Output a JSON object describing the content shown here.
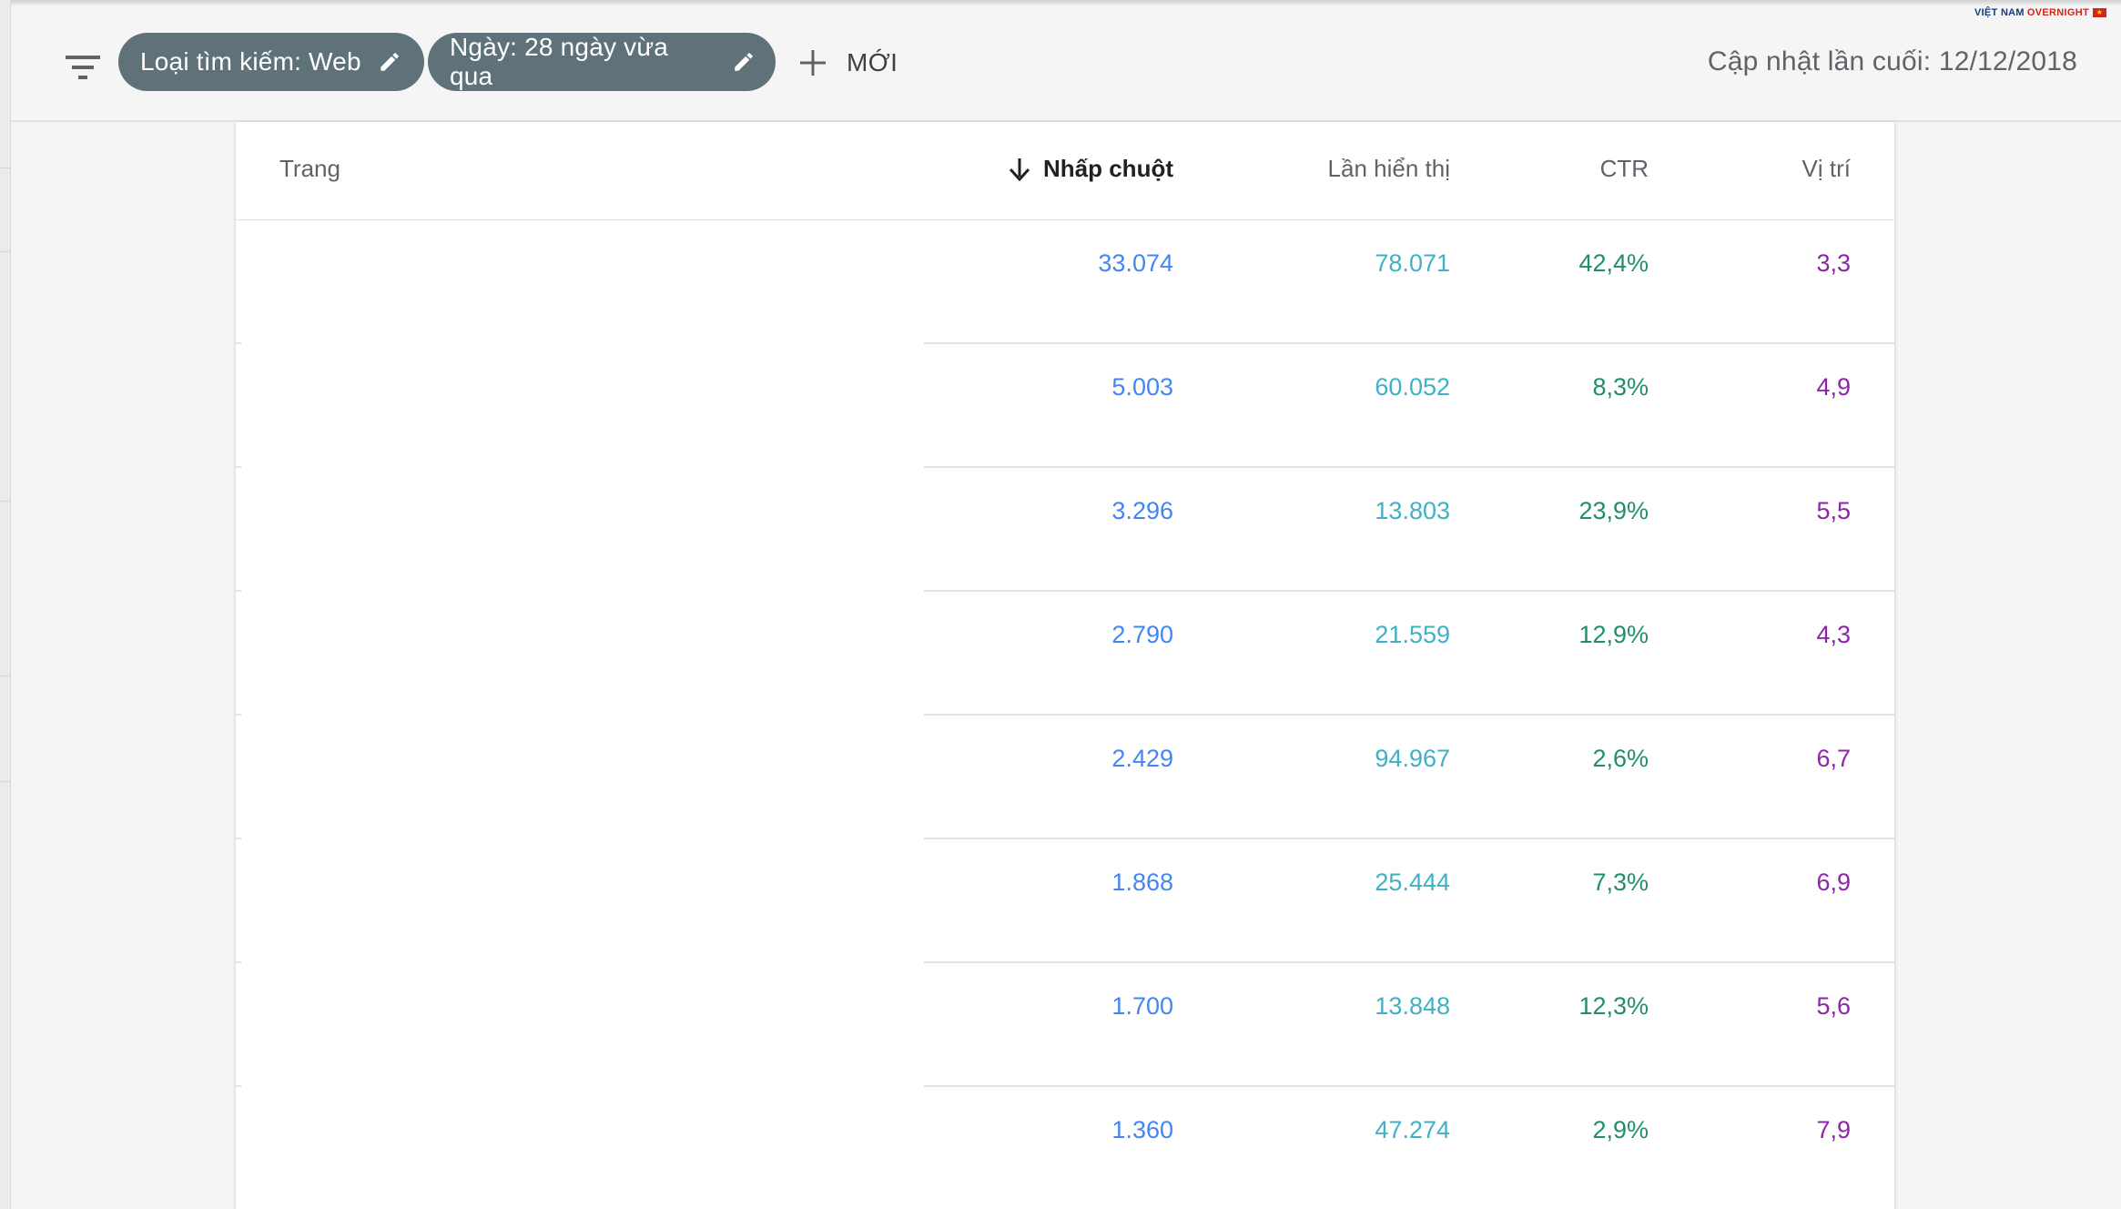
{
  "toolbar": {
    "filter_icon": "filter-list-icon",
    "chip_search_type": "Loại tìm kiếm: Web",
    "chip_date": "Ngày: 28 ngày vừa qua",
    "new_label": "MỚI",
    "last_updated": "Cập nhật lần cuối: 12/12/2018"
  },
  "brand": {
    "part1": "VIỆT NAM",
    "part2": "OVERNIGHT"
  },
  "table": {
    "headers": {
      "page": "Trang",
      "clicks": "Nhấp chuột",
      "impressions": "Lần hiển thị",
      "ctr": "CTR",
      "position": "Vị trí"
    },
    "sort_icon": "arrow-downward-icon",
    "rows": [
      {
        "page": "",
        "clicks": "33.074",
        "impressions": "78.071",
        "ctr": "42,4%",
        "position": "3,3"
      },
      {
        "page": "",
        "clicks": "5.003",
        "impressions": "60.052",
        "ctr": "8,3%",
        "position": "4,9"
      },
      {
        "page": "",
        "clicks": "3.296",
        "impressions": "13.803",
        "ctr": "23,9%",
        "position": "5,5"
      },
      {
        "page": "",
        "clicks": "2.790",
        "impressions": "21.559",
        "ctr": "12,9%",
        "position": "4,3"
      },
      {
        "page": "",
        "clicks": "2.429",
        "impressions": "94.967",
        "ctr": "2,6%",
        "position": "6,7"
      },
      {
        "page": "",
        "clicks": "1.868",
        "impressions": "25.444",
        "ctr": "7,3%",
        "position": "6,9"
      },
      {
        "page": "",
        "clicks": "1.700",
        "impressions": "13.848",
        "ctr": "12,3%",
        "position": "5,6"
      },
      {
        "page": "",
        "clicks": "1.360",
        "impressions": "47.274",
        "ctr": "2,9%",
        "position": "7,9"
      }
    ]
  },
  "colors": {
    "clicks": "#4285f4",
    "impressions": "#3fb1c5",
    "ctr": "#1e8e6f",
    "position": "#8e24aa",
    "chip_bg": "#5f7179"
  }
}
